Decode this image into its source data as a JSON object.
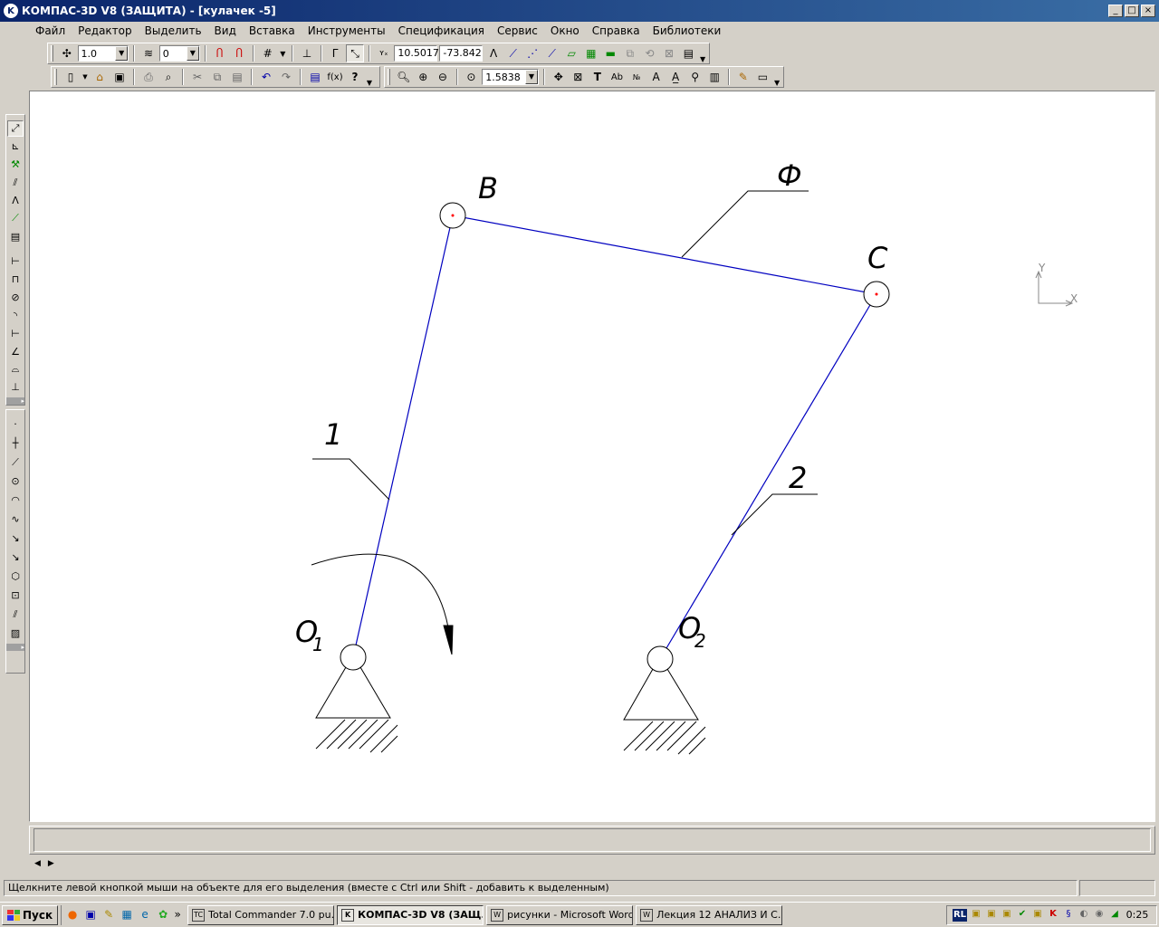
{
  "window": {
    "title": "КОМПАС-3D V8 (ЗАЩИТА) - [кулачек -5]",
    "buttons": [
      "_",
      "□",
      "×"
    ]
  },
  "menu": [
    {
      "label": "Файл"
    },
    {
      "label": "Редактор"
    },
    {
      "label": "Выделить"
    },
    {
      "label": "Вид"
    },
    {
      "label": "Вставка"
    },
    {
      "label": "Инструменты"
    },
    {
      "label": "Спецификация"
    },
    {
      "label": "Сервис"
    },
    {
      "label": "Окно"
    },
    {
      "label": "Справка"
    },
    {
      "label": "Библиотеки"
    }
  ],
  "toolbar_current": {
    "step_value": "1.0",
    "layer_value": "0",
    "coord_x": "10.5017",
    "coord_y": "-73.842"
  },
  "toolbar_standard": {
    "zoom_value": "1.5838"
  },
  "drawing": {
    "labels": {
      "B": "B",
      "C": "C",
      "phi": "Ф",
      "link1": "1",
      "link2": "2",
      "o1_main": "O",
      "o1_sub": "1",
      "o2_main": "O",
      "o2_sub": "2"
    },
    "axis": {
      "y": "Y",
      "x": "X"
    },
    "colors": {
      "link": "#0000c0",
      "annotation": "#000000",
      "point": "#ff0000"
    }
  },
  "status": {
    "message": "Щелкните левой кнопкой мыши на объекте для его выделения (вместе с Ctrl или Shift - добавить к выделенным)"
  },
  "taskbar": {
    "start_label": "Пуск",
    "tasks": [
      {
        "label": "Total Commander 7.0 pu...",
        "icon": "TC",
        "active": false
      },
      {
        "label": "КОМПАС-3D V8 (ЗАЩ...",
        "icon": "K",
        "active": true
      },
      {
        "label": "рисунки - Microsoft Word",
        "icon": "W",
        "active": false
      },
      {
        "label": "Лекция 12 АНАЛИЗ И С...",
        "icon": "W",
        "active": false
      }
    ],
    "lang": "RL",
    "clock": "0:25"
  }
}
